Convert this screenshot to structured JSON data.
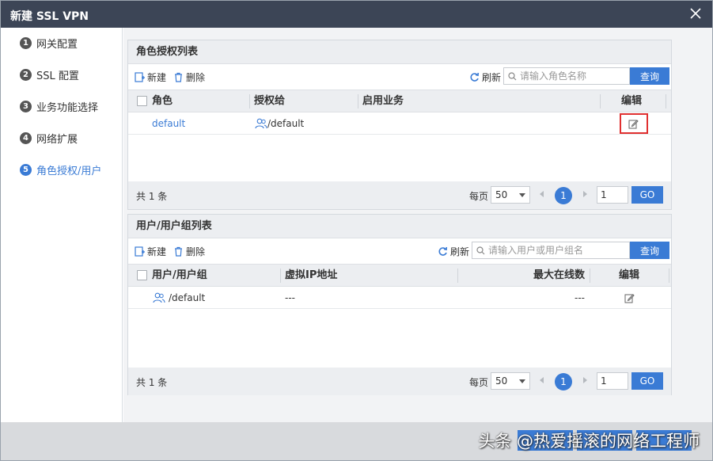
{
  "dialog": {
    "title": "新建 SSL VPN"
  },
  "sidebar": {
    "steps": [
      {
        "num": "1",
        "label": "网关配置"
      },
      {
        "num": "2",
        "label": "SSL 配置"
      },
      {
        "num": "3",
        "label": "业务功能选择"
      },
      {
        "num": "4",
        "label": "网络扩展"
      },
      {
        "num": "5",
        "label": "角色授权/用户"
      }
    ],
    "active_step": 5
  },
  "role_panel": {
    "title": "角色授权列表",
    "toolbar": {
      "new_label": "新建",
      "delete_label": "删除",
      "refresh_label": "刷新",
      "search_placeholder": "请输入角色名称",
      "query_label": "查询"
    },
    "columns": [
      "角色",
      "授权给",
      "启用业务",
      "编辑"
    ],
    "rows": [
      {
        "role": "default",
        "granted_to": "/default",
        "services": ""
      }
    ],
    "footer": {
      "total": "共 1 条",
      "per_page_label": "每页",
      "page_size": "50",
      "current_page": "1",
      "goto_value": "1",
      "go_label": "GO"
    }
  },
  "user_panel": {
    "title": "用户/用户组列表",
    "toolbar": {
      "new_label": "新建",
      "delete_label": "删除",
      "refresh_label": "刷新",
      "search_placeholder": "请输入用户或用户组名",
      "query_label": "查询"
    },
    "columns": [
      "用户/用户组",
      "虚拟IP地址",
      "最大在线数",
      "编辑"
    ],
    "rows": [
      {
        "user": "/default",
        "virtual_ip": "---",
        "max_online": "---"
      }
    ],
    "footer": {
      "total": "共 1 条",
      "per_page_label": "每页",
      "page_size": "50",
      "current_page": "1",
      "goto_value": "1",
      "go_label": "GO"
    }
  },
  "bottom": {
    "watermark": "头条 @热爱摇滚的网络工程师"
  },
  "colors": {
    "accent": "#3a7bd5",
    "titlebar": "#3c4556",
    "highlight": "#e03030"
  }
}
